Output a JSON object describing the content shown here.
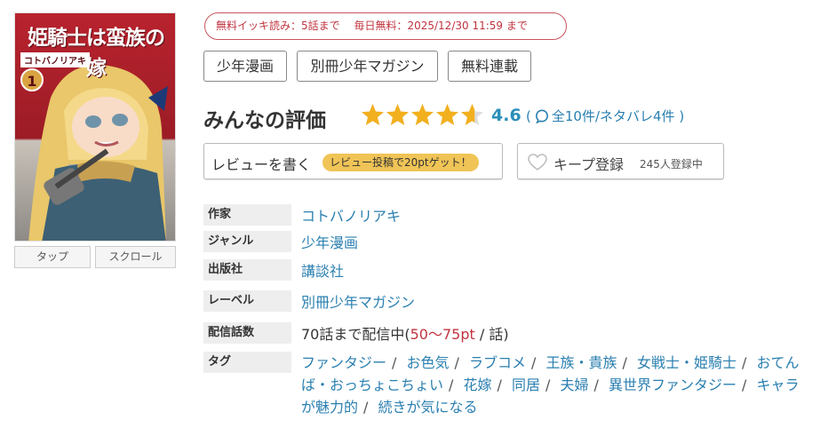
{
  "cover": {
    "title": "姫騎士は蛮族の嫁",
    "author": "コトバノリアキ",
    "volume": "1",
    "tabs": {
      "tap": "タップ",
      "scroll": "スクロール"
    }
  },
  "free_badge": {
    "text1": "無料イッキ読み：5話まで",
    "text2": "毎日無料：2025/12/30 11:59 まで"
  },
  "genres": [
    "少年漫画",
    "別冊少年マガジン",
    "無料連載"
  ],
  "rating": {
    "label": "みんなの評価",
    "score": "4.6",
    "stars": 4.6,
    "open_paren": "(",
    "reviews": "全10件/ネタバレ4件",
    "close_paren": ")"
  },
  "review_button": {
    "label": "レビューを書く",
    "reward": "レビュー投稿で20ptゲット！"
  },
  "keep_button": {
    "label": "キープ登録",
    "count": "245人登録中"
  },
  "info": {
    "author": {
      "key": "作家",
      "value": "コトバノリアキ"
    },
    "genre": {
      "key": "ジャンル",
      "value": "少年漫画"
    },
    "publisher": {
      "key": "出版社",
      "value": "講談社"
    },
    "label": {
      "key": "レーベル",
      "value": "別冊少年マガジン"
    },
    "episodes": {
      "key": "配信話数",
      "prefix": "70話まで配信中(",
      "price": "50〜75pt",
      "suffix": " / 話)"
    },
    "tags": {
      "key": "タグ",
      "items": [
        "ファンタジー",
        "お色気",
        "ラブコメ",
        "王族・貴族",
        "女戦士・姫騎士",
        "おてんば・おっちょこちょい",
        "花嫁",
        "同居",
        "夫婦",
        "異世界ファンタジー",
        "キャラが魅力的",
        "続きが気になる"
      ]
    }
  },
  "colors": {
    "accent_red": "#c0343f",
    "link_blue": "#2a7fb0",
    "star_gold": "#f2b01e",
    "reward_yellow": "#f0c456"
  }
}
